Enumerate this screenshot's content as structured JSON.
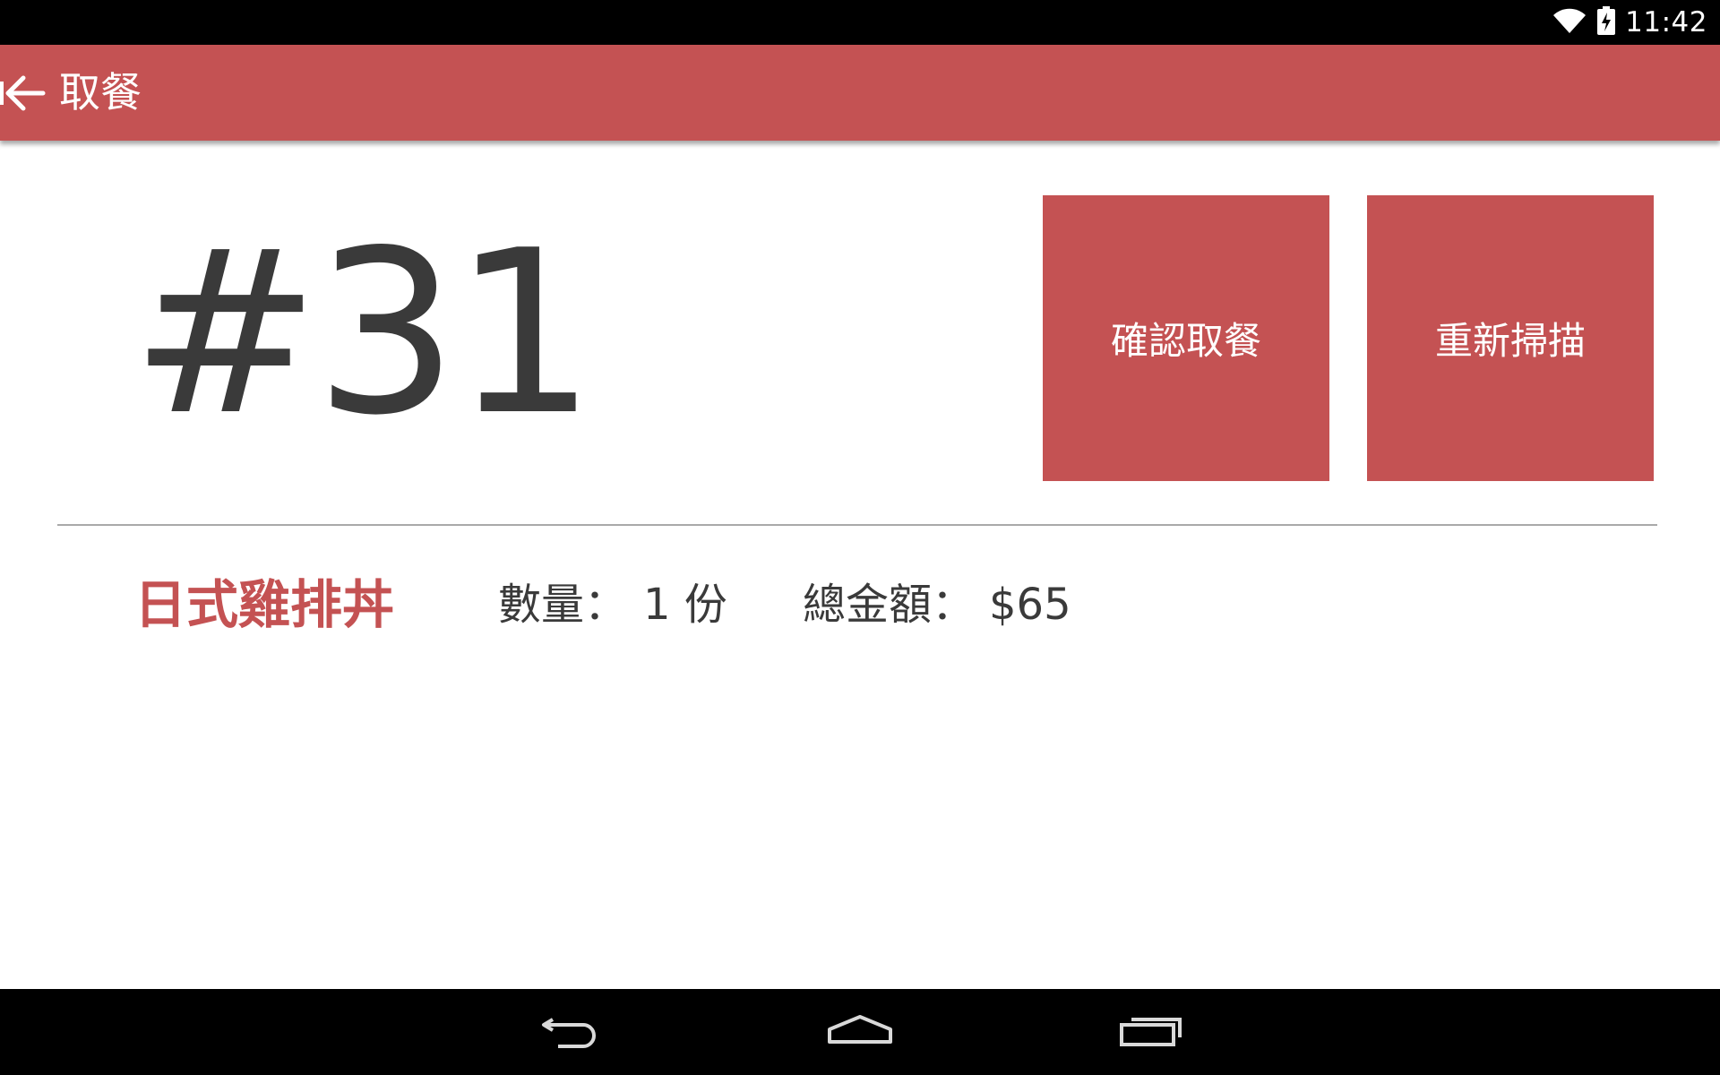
{
  "status_bar": {
    "time": "11:42",
    "icons": [
      "wifi-icon",
      "battery-charging-icon"
    ]
  },
  "action_bar": {
    "title": "取餐",
    "back_icon": "arrow-left-icon",
    "background_color": "#c45253"
  },
  "order": {
    "number": "#31"
  },
  "buttons": {
    "confirm_label": "確認取餐",
    "rescan_label": "重新掃描"
  },
  "item": {
    "name": "日式雞排丼",
    "quantity_label": "數量：",
    "quantity_value": "1 份",
    "total_label": "總金額：",
    "total_value": "$65"
  },
  "nav_bar": {
    "icons": [
      "back-icon",
      "home-icon",
      "recents-icon"
    ]
  },
  "colors": {
    "accent": "#c45253",
    "text_dark": "#3a3a3a",
    "divider": "#a9a9a9"
  }
}
